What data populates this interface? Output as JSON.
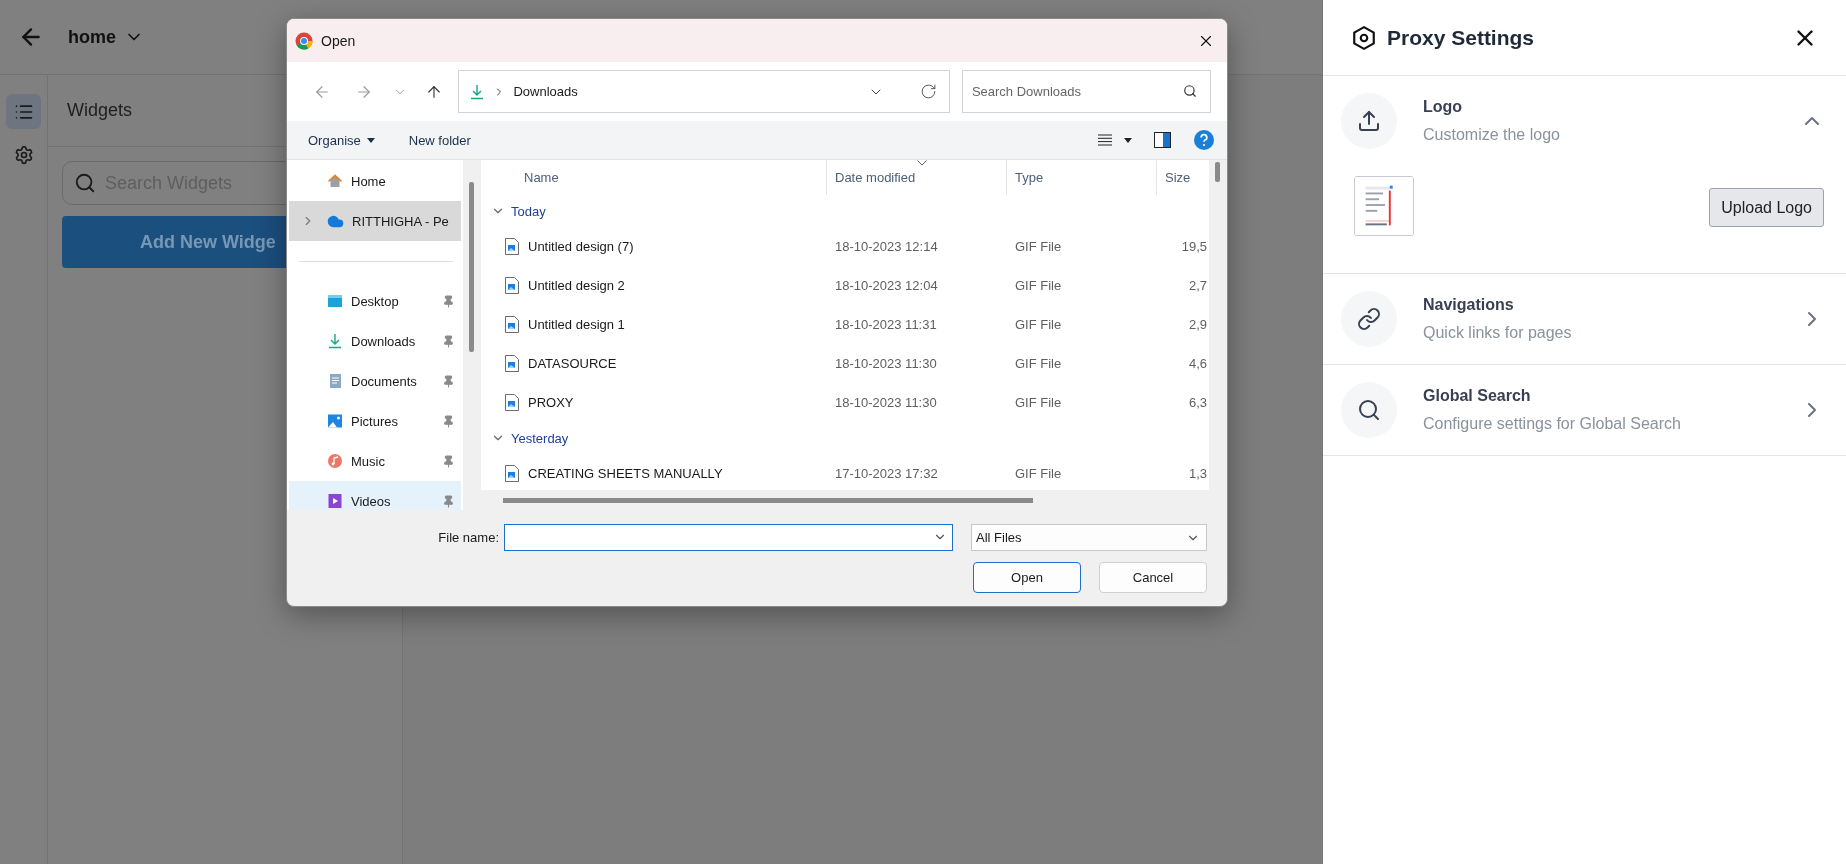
{
  "app": {
    "title": "home",
    "rail": [
      {
        "kind": "list",
        "selected": true
      },
      {
        "kind": "settings",
        "selected": false
      }
    ],
    "widgets": {
      "title": "Widgets",
      "search_placeholder": "Search Widgets",
      "add_button": "Add New Widge"
    }
  },
  "dialog": {
    "title": "Open",
    "address": "Downloads",
    "search_placeholder": "Search Downloads",
    "commands": [
      "Organise",
      "New folder"
    ],
    "nav": [
      {
        "items": [
          {
            "kind": "home",
            "label": "Home",
            "selected": false,
            "hovered": false,
            "pinned": false,
            "expandable": false
          },
          {
            "kind": "cloud",
            "label": "RITTHIGHA - Pe",
            "selected": true,
            "hovered": false,
            "pinned": false,
            "expandable": true
          }
        ]
      },
      {
        "items": [
          {
            "kind": "desktop",
            "label": "Desktop",
            "selected": false,
            "hovered": false,
            "pinned": true,
            "expandable": false
          },
          {
            "kind": "downloads",
            "label": "Downloads",
            "selected": false,
            "hovered": false,
            "pinned": true,
            "expandable": false
          },
          {
            "kind": "documents",
            "label": "Documents",
            "selected": false,
            "hovered": false,
            "pinned": true,
            "expandable": false
          },
          {
            "kind": "pictures",
            "label": "Pictures",
            "selected": false,
            "hovered": false,
            "pinned": true,
            "expandable": false
          },
          {
            "kind": "music",
            "label": "Music",
            "selected": false,
            "hovered": false,
            "pinned": true,
            "expandable": false
          },
          {
            "kind": "videos",
            "label": "Videos",
            "selected": false,
            "hovered": true,
            "pinned": true,
            "expandable": false
          }
        ]
      }
    ],
    "columns": [
      {
        "label": "Name",
        "sorted": false
      },
      {
        "label": "Date modified",
        "sorted": true
      },
      {
        "label": "Type",
        "sorted": false
      },
      {
        "label": "Size",
        "sorted": false
      }
    ],
    "groups": [
      {
        "label": "Today",
        "expanded": true,
        "files": [
          {
            "name": "Untitled design (7)",
            "date": "18-10-2023 12:14",
            "type": "GIF File",
            "size": "19,5"
          },
          {
            "name": "Untitled design 2",
            "date": "18-10-2023 12:04",
            "type": "GIF File",
            "size": "2,7"
          },
          {
            "name": "Untitled design 1",
            "date": "18-10-2023 11:31",
            "type": "GIF File",
            "size": "2,9"
          },
          {
            "name": "DATASOURCE",
            "date": "18-10-2023 11:30",
            "type": "GIF File",
            "size": "4,6"
          },
          {
            "name": "PROXY",
            "date": "18-10-2023 11:30",
            "type": "GIF File",
            "size": "6,3"
          }
        ]
      },
      {
        "label": "Yesterday",
        "expanded": true,
        "files": [
          {
            "name": "CREATING SHEETS MANUALLY",
            "date": "17-10-2023 17:32",
            "type": "GIF File",
            "size": "1,3"
          }
        ]
      }
    ],
    "file_name_label": "File name:",
    "filter": "All Files",
    "buttons": [
      {
        "label": "Open",
        "default": true
      },
      {
        "label": "Cancel",
        "default": false
      }
    ]
  },
  "panel": {
    "title": "Proxy Settings",
    "sections": [
      {
        "kind": "upload",
        "title": "Logo",
        "subtitle": "Customize the logo",
        "expanded": true,
        "action": "Upload Logo"
      },
      {
        "kind": "link",
        "title": "Navigations",
        "subtitle": "Quick links for pages",
        "expanded": false
      },
      {
        "kind": "search",
        "title": "Global Search",
        "subtitle": "Configure settings for Global Search",
        "expanded": false
      }
    ]
  }
}
